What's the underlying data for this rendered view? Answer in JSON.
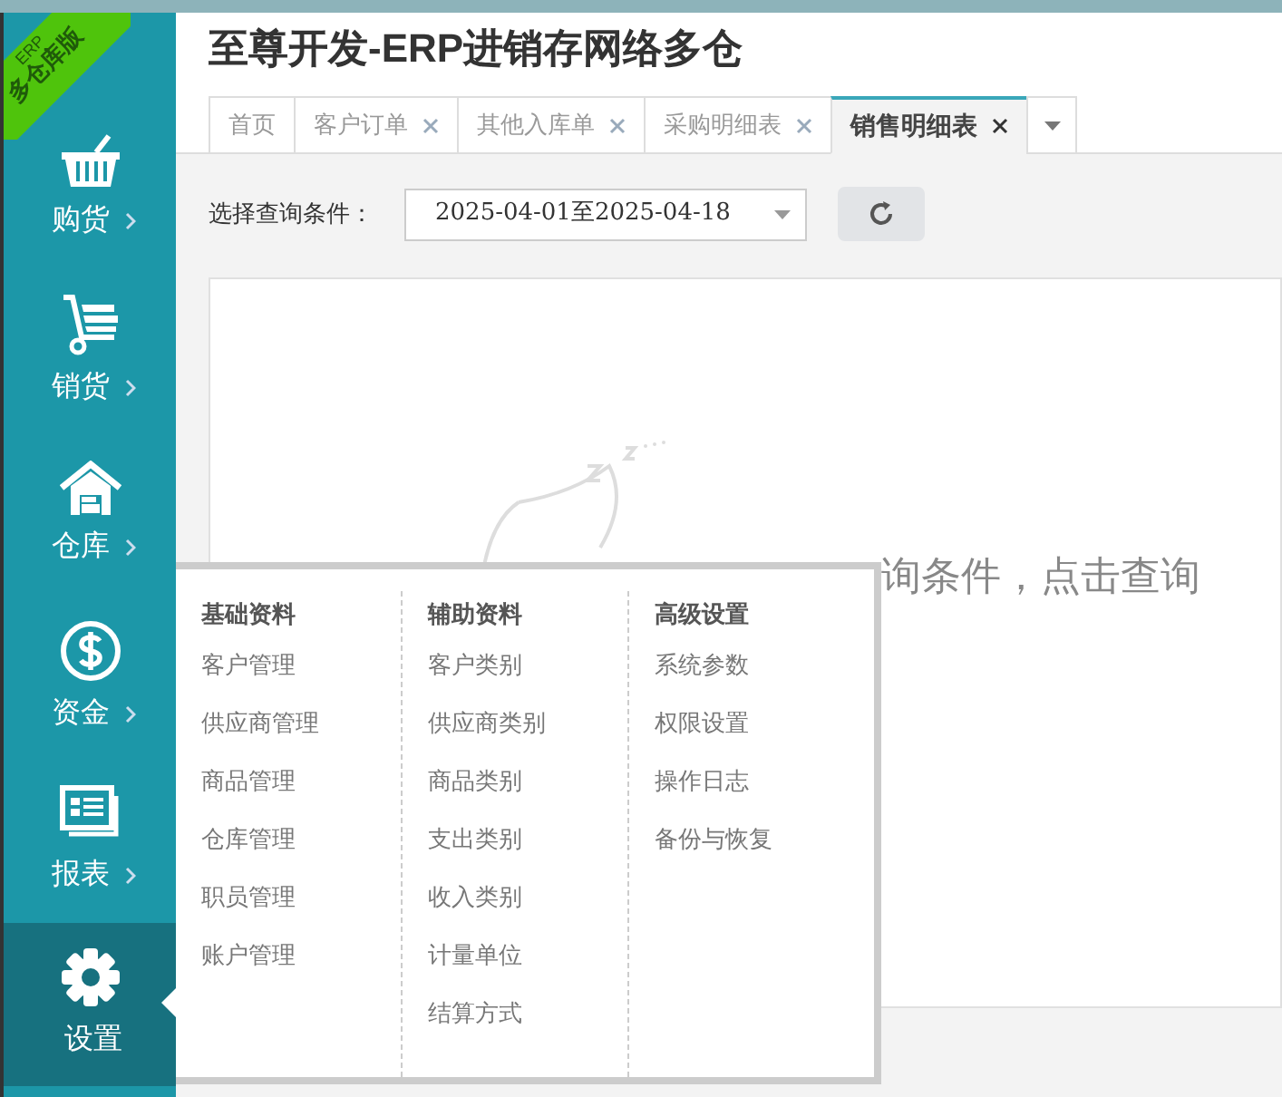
{
  "brand": {
    "badge_top": "ERP",
    "badge_bottom": "多仓库版",
    "title": "至尊开发-ERP进销存网络多仓"
  },
  "sidebar": {
    "items": [
      {
        "kind": "basket",
        "label": "购货",
        "selected": false,
        "has_arrow": true
      },
      {
        "kind": "cart",
        "label": "销货",
        "selected": false,
        "has_arrow": true
      },
      {
        "kind": "house",
        "label": "仓库",
        "selected": false,
        "has_arrow": true
      },
      {
        "kind": "dollar",
        "label": "资金",
        "selected": false,
        "has_arrow": true
      },
      {
        "kind": "report",
        "label": "报表",
        "selected": false,
        "has_arrow": true
      },
      {
        "kind": "gear",
        "label": "设置",
        "selected": true,
        "has_arrow": false
      }
    ]
  },
  "tabs": [
    {
      "label": "首页",
      "selected": false,
      "closable": false
    },
    {
      "label": "客户订单",
      "selected": false,
      "closable": true
    },
    {
      "label": "其他入库单",
      "selected": false,
      "closable": true
    },
    {
      "label": "采购明细表",
      "selected": false,
      "closable": true
    },
    {
      "label": "销售明细表",
      "selected": true,
      "closable": true
    }
  ],
  "query": {
    "label": "选择查询条件：",
    "date_range": "2025-04-01至2025-04-18"
  },
  "empty_state": {
    "message": "询条件，点击查询"
  },
  "settings_menu": {
    "columns": [
      {
        "heading": "基础资料",
        "items": [
          "客户管理",
          "供应商管理",
          "商品管理",
          "仓库管理",
          "职员管理",
          "账户管理"
        ]
      },
      {
        "heading": "辅助资料",
        "items": [
          "客户类别",
          "供应商类别",
          "商品类别",
          "支出类别",
          "收入类别",
          "计量单位",
          "结算方式"
        ]
      },
      {
        "heading": "高级设置",
        "items": [
          "系统参数",
          "权限设置",
          "操作日志",
          "备份与恢复"
        ]
      }
    ]
  }
}
